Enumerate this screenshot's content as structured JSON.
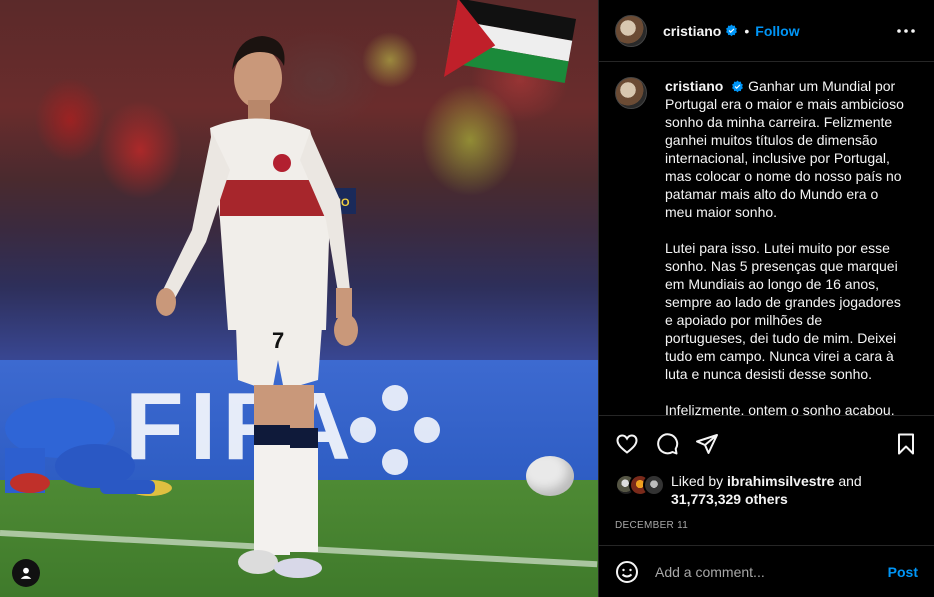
{
  "post": {
    "username": "cristiano",
    "verified": true,
    "follow_label": "Follow",
    "separator": "•",
    "caption_paragraphs": [
      "Ganhar um Mundial por Portugal era o maior e mais ambicioso sonho da minha carreira. Felizmente ganhei muitos títulos de dimensão internacional, inclusive por Portugal, mas colocar o nome do nosso país no patamar mais alto do Mundo era o meu maior sonho.",
      "Lutei para isso. Lutei muito por esse sonho. Nas 5 presenças que marquei em Mundiais ao longo de 16 anos, sempre ao lado de grandes jogadores e apoiado por milhões de portugueses, dei tudo de mim. Deixei tudo em campo. Nunca virei a cara à luta e nunca desisti desse sonho.",
      "Infelizmente, ontem o sonho acabou."
    ],
    "liked_by_prefix": "Liked by",
    "liked_by_user": "ibrahimsilvestre",
    "liked_by_and": "and",
    "others_count": "31,773,329 others",
    "date": "DECEMBER 11",
    "comment_placeholder": "Add a comment...",
    "post_label": "Post"
  },
  "photo": {
    "board_text": "FIFA",
    "jersey_number": "7"
  },
  "colors": {
    "accent": "#0095f6",
    "background": "#000000",
    "text": "#f5f5f5",
    "muted": "#a8a8a8",
    "border": "#262626"
  },
  "icons": {
    "more": "more-horizontal-icon",
    "like": "heart-icon",
    "comment": "comment-icon",
    "share": "share-icon",
    "save": "bookmark-icon",
    "emoji": "emoji-icon",
    "profile": "profile-icon",
    "verified": "verified-badge-icon"
  }
}
